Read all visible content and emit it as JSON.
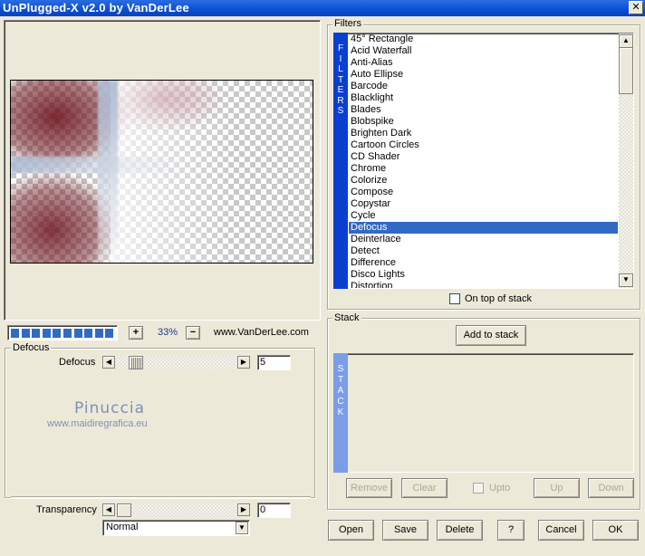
{
  "window": {
    "title": "UnPlugged-X v2.0 by VanDerLee",
    "close_glyph": "✕"
  },
  "preview": {
    "progress_segments": 10,
    "zoom_in": "+",
    "zoom_out": "−",
    "zoom": "33%",
    "website": "www.VanDerLee.com"
  },
  "params": {
    "group_label": "Defocus",
    "defocus_label": "Defocus",
    "defocus_value": "5",
    "transparency_label": "Transparency",
    "transparency_value": "0",
    "blend_mode": "Normal"
  },
  "watermark": {
    "name": "Pinuccia",
    "site": "www.maidiregrafica.eu"
  },
  "filters": {
    "group_label": "Filters",
    "tab_letters": [
      "F",
      "I",
      "L",
      "T",
      "E",
      "R",
      "S"
    ],
    "items": [
      "45° Rectangle",
      "Acid Waterfall",
      "Anti-Alias",
      "Auto Ellipse",
      "Barcode",
      "Blacklight",
      "Blades",
      "Blobspike",
      "Brighten Dark",
      "Cartoon Circles",
      "CD Shader",
      "Chrome",
      "Colorize",
      "Compose",
      "Copystar",
      "Cycle",
      "Defocus",
      "Deinterlace",
      "Detect",
      "Difference",
      "Disco Lights",
      "Distortion"
    ],
    "selected_index": 16,
    "on_top_label": "On top of stack"
  },
  "stack": {
    "group_label": "Stack",
    "add_label": "Add to stack",
    "tab_letters": [
      "S",
      "T",
      "A",
      "C",
      "K"
    ],
    "remove_label": "Remove",
    "clear_label": "Clear",
    "upto_label": "Upto",
    "up_label": "Up",
    "down_label": "Down"
  },
  "footer": {
    "open_label": "Open",
    "save_label": "Save",
    "delete_label": "Delete",
    "help_label": "?",
    "cancel_label": "Cancel",
    "ok_label": "OK"
  },
  "colors": {
    "title_bar": "#0a4fd4",
    "selection": "#316ac5",
    "tab_bg": "#0a3fd0",
    "stack_tab_bg": "#7b9de8"
  }
}
